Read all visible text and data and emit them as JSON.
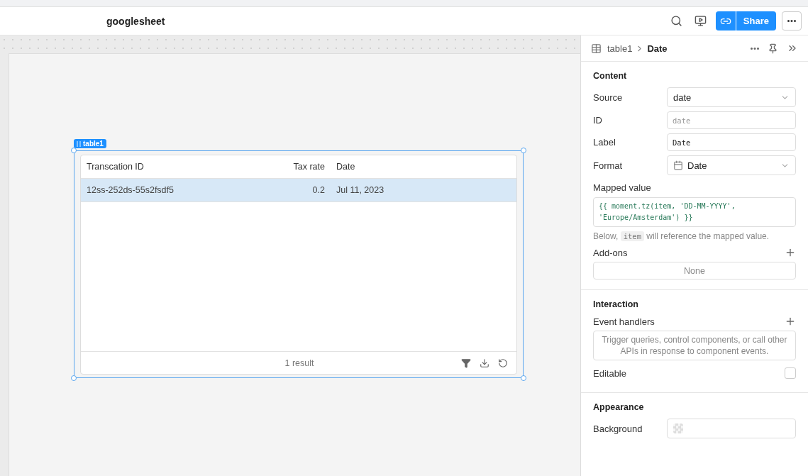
{
  "header": {
    "title": "googlesheet",
    "share_label": "Share"
  },
  "canvas": {
    "widget_label": "table1",
    "table": {
      "columns": [
        "Transcation ID",
        "Tax rate",
        "Date"
      ],
      "rows": [
        {
          "cells": [
            "12ss-252ds-55s2fsdf5",
            "0.2",
            "Jul 11, 2023"
          ],
          "selected": true
        }
      ],
      "footer": "1 result"
    }
  },
  "inspector": {
    "breadcrumb": {
      "parent": "table1",
      "current": "Date"
    },
    "content": {
      "title": "Content",
      "fields": [
        {
          "kind": "select",
          "label": "Source",
          "value": "date"
        },
        {
          "kind": "input",
          "label": "ID",
          "placeholder": "date"
        },
        {
          "kind": "input",
          "label": "Label",
          "value": "Date"
        },
        {
          "kind": "select-icon",
          "label": "Format",
          "value": "Date"
        }
      ],
      "mapped_label": "Mapped value",
      "mapped_lines": [
        "{{ moment.tz(item, 'DD-MM-YYYY',",
        "'Europe/Amsterdam') }}"
      ],
      "hint_before": "Below,",
      "hint_code": "item",
      "hint_after": "will reference the mapped value.",
      "addons_label": "Add-ons",
      "addons_value": "None"
    },
    "interaction": {
      "title": "Interaction",
      "events_label": "Event handlers",
      "events_empty": "Trigger queries, control components, or call other APIs in response to component events.",
      "editable_label": "Editable",
      "editable": false
    },
    "appearance": {
      "title": "Appearance",
      "background_label": "Background"
    }
  }
}
